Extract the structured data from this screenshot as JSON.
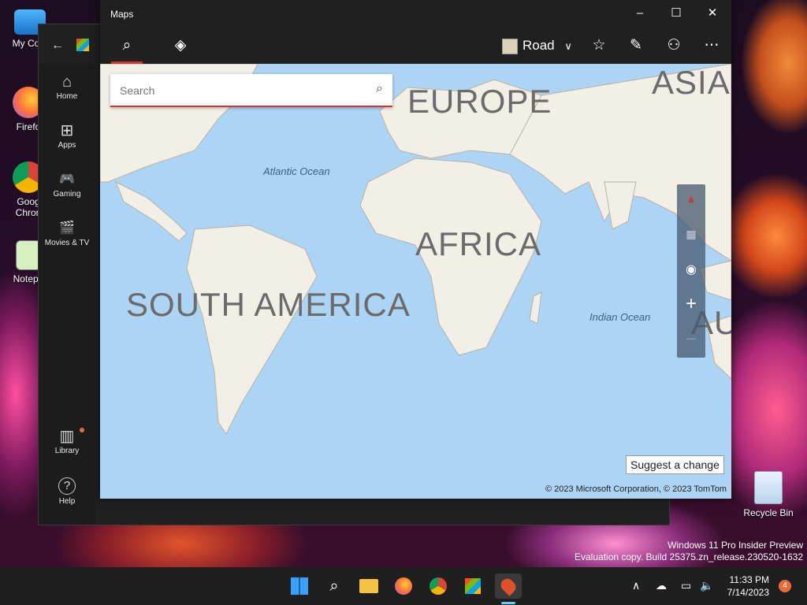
{
  "desktop": {
    "icons": [
      {
        "label": "My Com",
        "icon": "computer-icon"
      },
      {
        "label": "Firefo",
        "icon": "firefox-icon"
      },
      {
        "label": "Goog Chron",
        "icon": "chrome-icon"
      },
      {
        "label": "Notepa",
        "icon": "notepad-icon"
      }
    ],
    "recycle_bin": "Recycle Bin",
    "watermark_line1": "Windows 11 Pro Insider Preview",
    "watermark_line2": "Evaluation copy. Build 25375.zn_release.230520-1632"
  },
  "store": {
    "nav": [
      {
        "label": "Home",
        "icon": "⌂"
      },
      {
        "label": "Apps",
        "icon": "⊞"
      },
      {
        "label": "Gaming",
        "icon": "🎮"
      },
      {
        "label": "Movies & TV",
        "icon": "🎬"
      },
      {
        "label": "Library",
        "icon": "▥"
      },
      {
        "label": "Help",
        "icon": "?"
      }
    ]
  },
  "maps": {
    "title": "Maps",
    "view_mode": "Road",
    "search_placeholder": "Search",
    "continents": [
      "EUROPE",
      "ASIA",
      "AFRICA",
      "SOUTH AMERICA",
      "AU"
    ],
    "oceans": [
      "Atlantic Ocean",
      "Indian Ocean"
    ],
    "suggest_label": "Suggest a change",
    "copyright": "© 2023 Microsoft Corporation, © 2023 TomTom",
    "colors": {
      "water": "#acd4f4",
      "land": "#f2efe6",
      "accent": "#d13438"
    }
  },
  "taskbar": {
    "time": "11:33 PM",
    "date": "7/14/2023",
    "notification_count": "4"
  }
}
